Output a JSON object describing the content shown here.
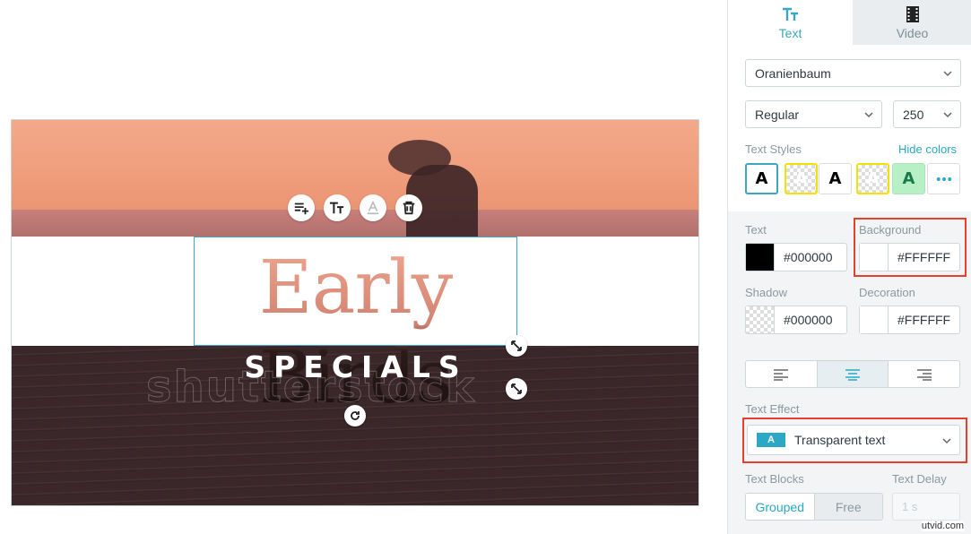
{
  "canvas": {
    "title_text": "Early Birds",
    "subtitle_text": "SPECIALS",
    "watermark": "shutterstock"
  },
  "toolbar": {
    "add_block_icon": "playlist-add-icon",
    "text_style_icon": "text-size-icon",
    "text_color_icon": "text-color-icon",
    "delete_icon": "trash-icon"
  },
  "tabs": [
    {
      "label": "Text",
      "icon": "text-size-icon",
      "active": true
    },
    {
      "label": "Video",
      "icon": "film-icon",
      "active": false
    }
  ],
  "font": {
    "family": "Oranienbaum",
    "weight": "Regular",
    "size": "250"
  },
  "text_styles": {
    "label": "Text Styles",
    "toggle_link": "Hide colors",
    "swatch_letter": "A",
    "more_icon": "more-dots-icon"
  },
  "colors": {
    "text_label": "Text",
    "text_value": "#000000",
    "background_label": "Background",
    "background_value": "#FFFFFF",
    "shadow_label": "Shadow",
    "shadow_value": "#000000",
    "decoration_label": "Decoration",
    "decoration_value": "#FFFFFF"
  },
  "alignment": {
    "options": [
      "align-left-icon",
      "align-center-icon",
      "align-right-icon"
    ],
    "selected": "center"
  },
  "text_effect": {
    "label": "Text Effect",
    "icon_letter": "A",
    "value": "Transparent text"
  },
  "text_blocks": {
    "label": "Text Blocks",
    "options": [
      "Grouped",
      "Free"
    ],
    "selected": "Grouped"
  },
  "text_delay": {
    "label": "Text Delay",
    "value": "1 s"
  },
  "credit": "utvid.com",
  "accent_color": "#2aa8c4",
  "highlight_color": "#e4412b"
}
